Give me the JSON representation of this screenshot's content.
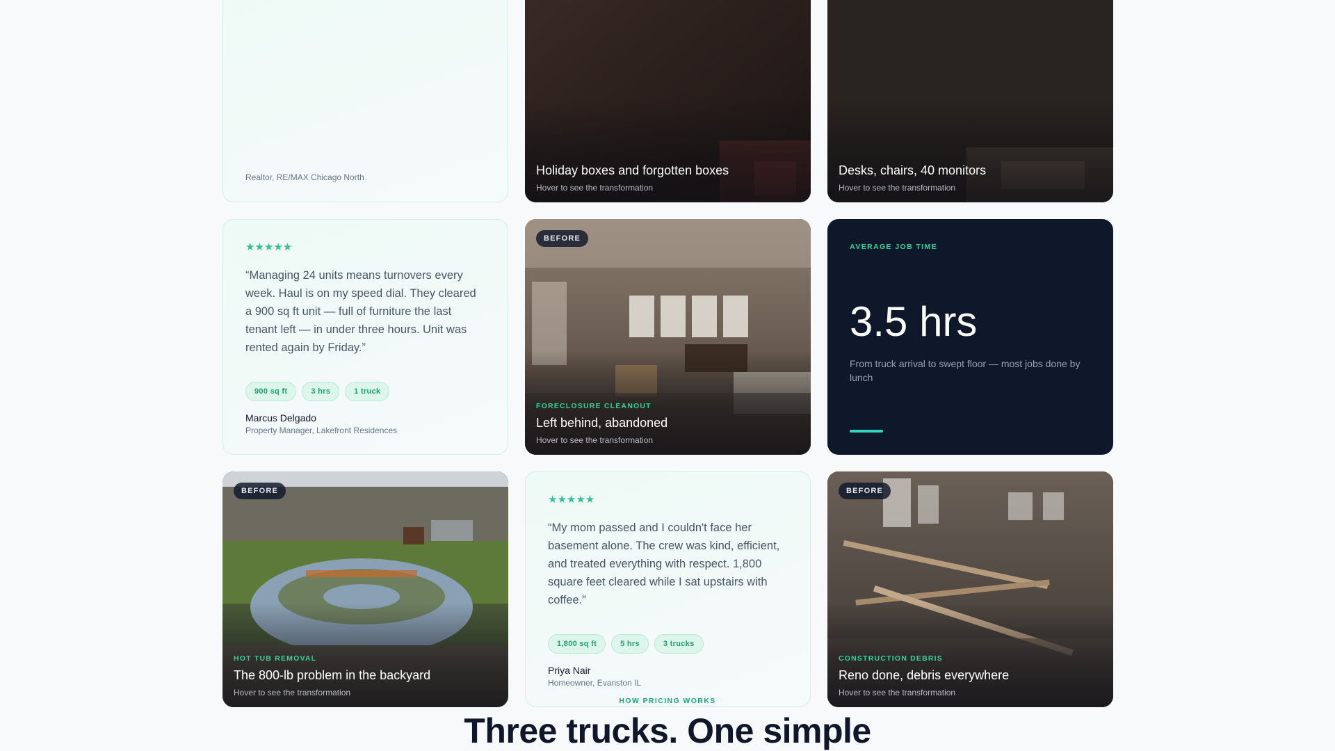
{
  "cards": {
    "top_testimonial": {
      "role": "Realtor, RE/MAX Chicago North"
    },
    "top_image_1": {
      "title": "Holiday boxes and forgotten boxes",
      "hint": "Hover to see the transformation"
    },
    "top_image_2": {
      "title": "Desks, chairs, 40 monitors",
      "hint": "Hover to see the transformation"
    },
    "testimonial_marcus": {
      "stars": "★★★★★",
      "quote": "“Managing 24 units means turnovers every week. Haul is on my speed dial. They cleared a 900 sq ft unit — full of furniture the last tenant left — in under three hours. Unit was rented again by Friday.”",
      "chips": [
        "900 sq ft",
        "3 hrs",
        "1 truck"
      ],
      "author": "Marcus Delgado",
      "role": "Property Manager, Lakefront Residences"
    },
    "foreclosure": {
      "badge": "BEFORE",
      "category": "FORECLOSURE CLEANOUT",
      "title": "Left behind, abandoned",
      "hint": "Hover to see the transformation"
    },
    "stat": {
      "label": "AVERAGE JOB TIME",
      "value": "3.5 hrs",
      "description": "From truck arrival to swept floor — most jobs done by lunch"
    },
    "hot_tub": {
      "badge": "BEFORE",
      "category": "HOT TUB REMOVAL",
      "title": "The 800-lb problem in the backyard",
      "hint": "Hover to see the transformation"
    },
    "testimonial_priya": {
      "stars": "★★★★★",
      "quote": "“My mom passed and I couldn't face her basement alone. The crew was kind, efficient, and treated everything with respect. 1,800 square feet cleared while I sat upstairs with coffee.”",
      "chips": [
        "1,800 sq ft",
        "5 hrs",
        "3 trucks"
      ],
      "author": "Priya Nair",
      "role": "Homeowner, Evanston IL"
    },
    "construction": {
      "badge": "BEFORE",
      "category": "CONSTRUCTION DEBRIS",
      "title": "Reno done, debris everywhere",
      "hint": "Hover to see the transformation"
    }
  },
  "pricing": {
    "eyebrow": "HOW PRICING WORKS",
    "title": "Three trucks. One simple"
  },
  "colors": {
    "accent": "#34d399",
    "dark": "#0f172a",
    "chip_bg": "#dcf6ec"
  }
}
